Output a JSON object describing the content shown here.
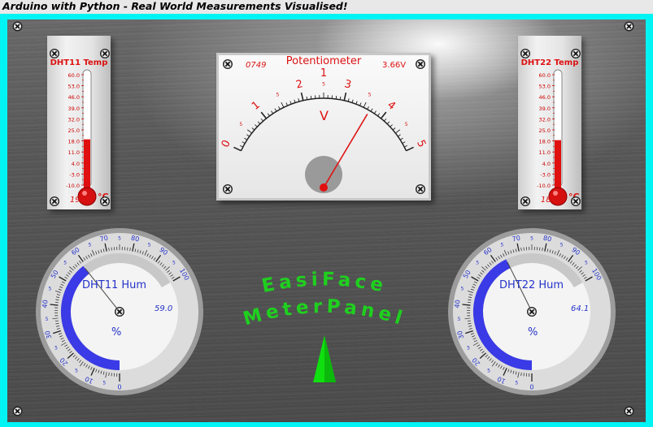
{
  "window": {
    "title": "Arduino with Python - Real World Measurements Visualised!"
  },
  "thermometers": [
    {
      "title": "DHT11 Temp",
      "value": "19.0",
      "reading": 19.0,
      "unit": "°C",
      "scale": [
        "60.0",
        "53.0",
        "46.0",
        "39.0",
        "32.0",
        "25.0",
        "18.0",
        "11.0",
        "4.0",
        "-3.0",
        "-10.0"
      ]
    },
    {
      "title": "DHT22 Temp",
      "value": "18.5",
      "reading": 18.5,
      "unit": "°C",
      "scale": [
        "60.0",
        "53.0",
        "46.0",
        "39.0",
        "32.0",
        "25.0",
        "18.0",
        "11.0",
        "4.0",
        "-3.0",
        "-10.0"
      ]
    }
  ],
  "voltmeter": {
    "title": "Potentiometer 1",
    "raw": "0749",
    "value": "3.66V",
    "reading": 3.66,
    "unit": "V",
    "labels": [
      "0",
      "1",
      "2",
      "3",
      "4",
      "5"
    ],
    "minor_labels": [
      "5",
      "5",
      "5",
      "5",
      "5"
    ]
  },
  "hygrometers": [
    {
      "title": "DHT11 Hum",
      "value": "59.0",
      "reading": 59.0,
      "unit": "%",
      "labels": [
        "0",
        "10",
        "20",
        "30",
        "40",
        "50",
        "60",
        "70",
        "80",
        "90",
        "100"
      ],
      "minor_labels": [
        "5",
        "5",
        "5",
        "5",
        "5",
        "5",
        "5",
        "5",
        "5",
        "5"
      ]
    },
    {
      "title": "DHT22 Hum",
      "value": "64.1",
      "reading": 64.1,
      "unit": "%",
      "labels": [
        "0",
        "10",
        "20",
        "30",
        "40",
        "50",
        "60",
        "70",
        "80",
        "90",
        "100"
      ],
      "minor_labels": [
        "5",
        "5",
        "5",
        "5",
        "5",
        "5",
        "5",
        "5",
        "5",
        "5"
      ]
    }
  ],
  "brand": {
    "line1": "EasiFace",
    "line2": "MeterPanel"
  },
  "colors": {
    "frame": "#00f4f4",
    "accent_red": "#dd1111",
    "gauge_blue": "#2533c8",
    "brand_green": "#1fd01f"
  }
}
